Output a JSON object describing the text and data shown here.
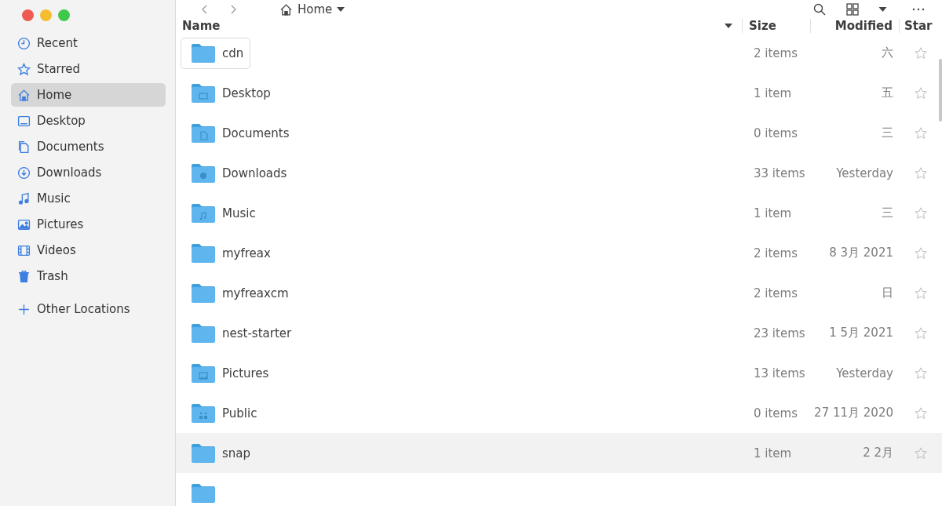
{
  "sidebar": {
    "items": [
      {
        "label": "Recent",
        "kind": "recent",
        "selected": false
      },
      {
        "label": "Starred",
        "kind": "starred",
        "selected": false
      },
      {
        "label": "Home",
        "kind": "home",
        "selected": true
      },
      {
        "label": "Desktop",
        "kind": "desktop",
        "selected": false
      },
      {
        "label": "Documents",
        "kind": "documents",
        "selected": false
      },
      {
        "label": "Downloads",
        "kind": "downloads",
        "selected": false
      },
      {
        "label": "Music",
        "kind": "music",
        "selected": false
      },
      {
        "label": "Pictures",
        "kind": "pictures",
        "selected": false
      },
      {
        "label": "Videos",
        "kind": "videos",
        "selected": false
      },
      {
        "label": "Trash",
        "kind": "trash",
        "selected": false
      }
    ],
    "other": {
      "label": "Other Locations"
    }
  },
  "path_bar": {
    "location": "Home"
  },
  "table": {
    "columns": [
      "Name",
      "Size",
      "Modified",
      "Star"
    ],
    "rows": [
      {
        "name": "cdn",
        "kind": "plain",
        "size": "2 items",
        "modified": "六",
        "focused": true,
        "selected": false,
        "starred": false
      },
      {
        "name": "Desktop",
        "kind": "desktop",
        "size": "1 item",
        "modified": "五",
        "focused": false,
        "selected": false,
        "starred": false
      },
      {
        "name": "Documents",
        "kind": "documents",
        "size": "0 items",
        "modified": "三",
        "focused": false,
        "selected": false,
        "starred": false
      },
      {
        "name": "Downloads",
        "kind": "downloads",
        "size": "33 items",
        "modified": "Yesterday",
        "focused": false,
        "selected": false,
        "starred": false
      },
      {
        "name": "Music",
        "kind": "music",
        "size": "1 item",
        "modified": "三",
        "focused": false,
        "selected": false,
        "starred": false
      },
      {
        "name": "myfreax",
        "kind": "plain",
        "size": "2 items",
        "modified": "8 3月 2021",
        "focused": false,
        "selected": false,
        "starred": false
      },
      {
        "name": "myfreaxcm",
        "kind": "plain",
        "size": "2 items",
        "modified": "日",
        "focused": false,
        "selected": false,
        "starred": false
      },
      {
        "name": "nest-starter",
        "kind": "plain",
        "size": "23 items",
        "modified": "1 5月 2021",
        "focused": false,
        "selected": false,
        "starred": false
      },
      {
        "name": "Pictures",
        "kind": "pictures",
        "size": "13 items",
        "modified": "Yesterday",
        "focused": false,
        "selected": false,
        "starred": false
      },
      {
        "name": "Public",
        "kind": "public",
        "size": "0 items",
        "modified": "27 11月 2020",
        "focused": false,
        "selected": false,
        "starred": false
      },
      {
        "name": "snap",
        "kind": "plain",
        "size": "1 item",
        "modified": "2 2月",
        "focused": false,
        "selected": true,
        "starred": false
      }
    ]
  }
}
